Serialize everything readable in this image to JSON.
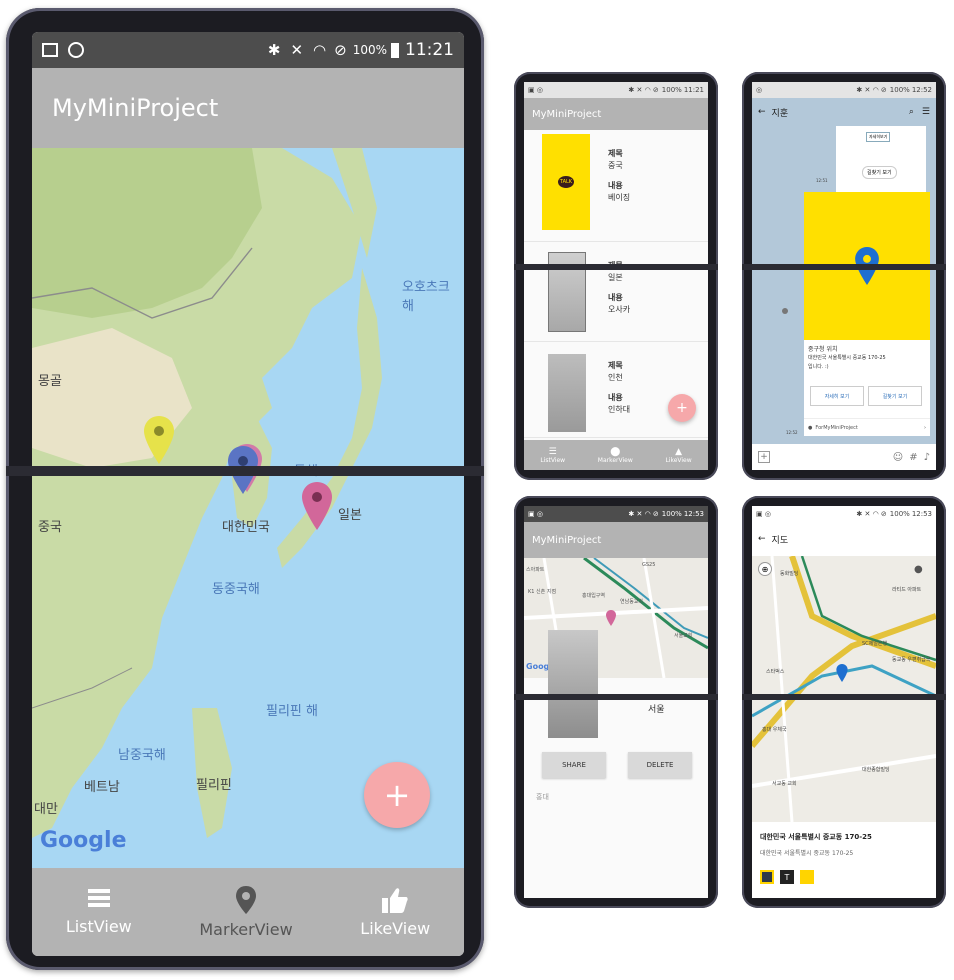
{
  "big_phone": {
    "status": {
      "battery": "100%",
      "time": "11:21"
    },
    "app_title": "MyMiniProject",
    "map_labels": {
      "okhotsk": "오호츠크 해",
      "mongolia": "몽골",
      "china": "중국",
      "korea": "대한민국",
      "east_sea": "동해",
      "japan": "일본",
      "east_china_sea": "동중국해",
      "philippine_sea": "필리핀 해",
      "south_china_sea": "남중국해",
      "vietnam": "베트남",
      "philippines": "필리핀",
      "taiwan": "대만"
    },
    "google": "Google",
    "fab": "+",
    "nav": [
      {
        "label": "ListView",
        "icon": "list-icon"
      },
      {
        "label": "MarkerView",
        "icon": "location-pin-icon"
      },
      {
        "label": "LikeView",
        "icon": "thumbs-up-icon"
      }
    ],
    "pin_colors": {
      "yellow": "#e6e24a",
      "blue": "#5a74c4",
      "pink": "#d2679a"
    }
  },
  "list_phone": {
    "status": {
      "battery": "100%",
      "time": "11:21"
    },
    "app_title": "MyMiniProject",
    "items": [
      {
        "title_label": "제목",
        "title": "중국",
        "content_label": "내용",
        "content": "베이징",
        "thumb_text": "TALK"
      },
      {
        "title_label": "제목",
        "title": "일본",
        "content_label": "내용",
        "content": "오사카"
      },
      {
        "title_label": "제목",
        "title": "인천",
        "content_label": "내용",
        "content": "인하대"
      }
    ],
    "fab": "+",
    "nav": [
      "ListView",
      "MarkerView",
      "LikeView"
    ]
  },
  "chat_phone": {
    "status": {
      "battery": "100%",
      "time": "12:52"
    },
    "header_title": "지훈",
    "card_address_title": "중구청 위치",
    "card_address_line": "대한민국 서울특별시 중교동 170-25",
    "card_address_line2": "입니다. :)",
    "btn_left": "자세히 보기",
    "btn_right": "길찾기 보기",
    "footer": "ForMyMiniProject",
    "bubble_top_btn": "길찾기 보기",
    "bubble_small_btn": "자세히보기",
    "time_small": "12:51",
    "time_small2": "12:52"
  },
  "detail_phone": {
    "status": {
      "battery": "100%",
      "time": "12:53"
    },
    "app_title": "MyMiniProject",
    "place": "서울",
    "share": "SHARE",
    "delete": "DELETE",
    "memo": "홍대",
    "google": "Google",
    "map_labels": [
      "스아파트",
      "GS25",
      "K1 신촌 지점",
      "홍대입구역",
      "홍대입구역",
      "GS25",
      "연남동교회",
      "CU",
      "CU",
      "서울교회",
      "한빛빌딩",
      "유진"
    ]
  },
  "kakaomap_phone": {
    "status": {
      "battery": "100%",
      "time": "12:53"
    },
    "header_title": "지도",
    "address_title": "대한민국 서울특별시 중교동 170-25",
    "address_sub": "대한민국 서울특별시 중교동 170-25",
    "map_labels": [
      "동화빌딩",
      "레지던스",
      "라티드 아파트",
      "SC제일은행",
      "동교동 우편취급국",
      "스타벅스",
      "동교동삼거리",
      "홍대 우체국",
      "대한종합빌딩",
      "서교동 교회",
      "서교동 홍대",
      "대한민국 기상청"
    ]
  }
}
